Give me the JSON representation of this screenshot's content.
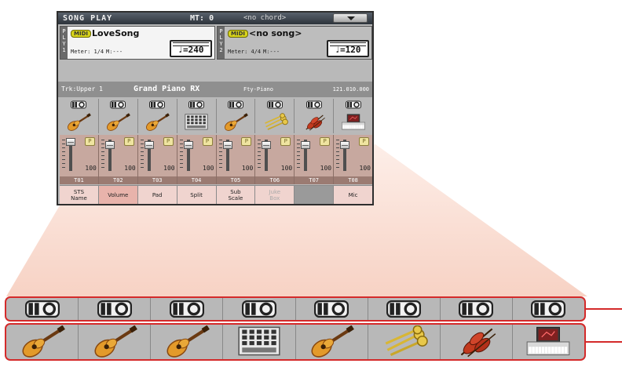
{
  "colors": {
    "callout": "#d42a2a",
    "zoom_cone": "#f7d2c4",
    "mixer_bg": "#c7a89f"
  },
  "header": {
    "mode": "SONG PLAY",
    "mt": "MT: 0",
    "chord": "<no chord>",
    "menu_icon": "chevron-down-icon"
  },
  "players": [
    {
      "tab": "P L Y 1",
      "badge": "MIDI",
      "song": "LoveSong",
      "meter": "Meter: 1/4",
      "measure": "M:---",
      "tempo": "♩=240"
    },
    {
      "tab": "P L Y 2",
      "badge": "MIDI",
      "song": "<no song>",
      "meter": "Meter: 4/4",
      "measure": "M:---",
      "tempo": "♩=120"
    }
  ],
  "track_info": {
    "track": "Trk:Upper 1",
    "program": "Grand Piano RX",
    "category": "Fty-Piano",
    "bank": "121.010.000"
  },
  "tracks": [
    {
      "play_icon": "play-mute-icon",
      "instrument_icon": "guitar-icon",
      "volume": "100",
      "name": "T01"
    },
    {
      "play_icon": "play-mute-icon",
      "instrument_icon": "guitar-icon",
      "volume": "100",
      "name": "T02"
    },
    {
      "play_icon": "play-mute-icon",
      "instrument_icon": "guitar-icon",
      "volume": "100",
      "name": "T03"
    },
    {
      "play_icon": "play-mute-icon",
      "instrument_icon": "drum-machine-icon",
      "volume": "100",
      "name": "T04"
    },
    {
      "play_icon": "play-mute-icon",
      "instrument_icon": "guitar-icon",
      "volume": "100",
      "name": "T05"
    },
    {
      "play_icon": "play-mute-icon",
      "instrument_icon": "brass-icon",
      "volume": "100",
      "name": "T06"
    },
    {
      "play_icon": "play-mute-icon",
      "instrument_icon": "strings-icon",
      "volume": "100",
      "name": "T07"
    },
    {
      "play_icon": "play-mute-icon",
      "instrument_icon": "keyboard-icon",
      "volume": "100",
      "name": "T08"
    }
  ],
  "play_button_label": "P",
  "tabs": [
    {
      "label": "STS Name",
      "state": "normal"
    },
    {
      "label": "Volume",
      "state": "selected"
    },
    {
      "label": "Pad",
      "state": "normal"
    },
    {
      "label": "Split",
      "state": "normal"
    },
    {
      "label": "Sub Scale",
      "state": "normal"
    },
    {
      "label": "Juke Box",
      "state": "disabled"
    },
    {
      "label": "",
      "state": "empty"
    },
    {
      "label": "Mic",
      "state": "normal"
    }
  ]
}
